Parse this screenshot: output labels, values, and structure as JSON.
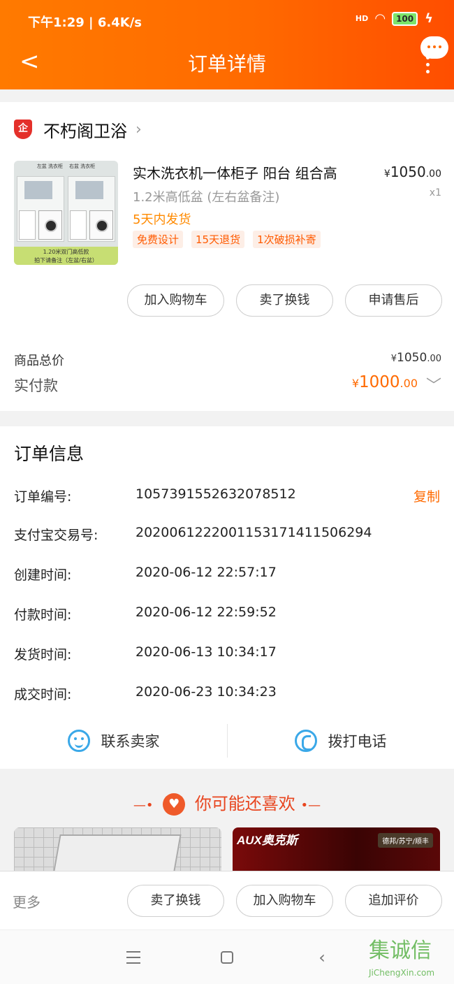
{
  "status_bar": {
    "left_text": "下午1:29 | 6.4K/s",
    "signal": "HD",
    "battery": "100"
  },
  "header": {
    "title": "订单详情",
    "back_icon": "chevron-left-icon",
    "more_icon": "more-vertical-icon"
  },
  "shop": {
    "badge": "企",
    "name": "不朽阁卫浴",
    "product": {
      "image_top_left": "左盆 洗衣柜",
      "image_top_right": "右盆 洗衣柜",
      "image_caption_1": "1.20米双门高低款",
      "image_caption_2": "拍下请备注（左盆/右盆）",
      "title": "实木洗衣机一体柜子 阳台 组合高",
      "price_currency": "¥",
      "price_int": "1050",
      "price_dec": ".00",
      "sku": "1.2米高低盆 (左右盆备注)",
      "qty": "x1",
      "shipping": "5天内发货",
      "tags": [
        "免费设计",
        "15天退货",
        "1次破损补寄"
      ]
    },
    "actions": [
      "加入购物车",
      "卖了换钱",
      "申请售后"
    ],
    "total_label": "商品总价",
    "total_currency": "¥",
    "total_int": "1050",
    "total_dec": ".00",
    "paid_label": "实付款",
    "paid_currency": "¥",
    "paid_int": "1000",
    "paid_dec": ".00"
  },
  "order_info": {
    "title": "订单信息",
    "copy_label": "复制",
    "rows": [
      {
        "label": "订单编号:",
        "value": "1057391552632078512"
      },
      {
        "label": "支付宝交易号:",
        "value": "2020061222001153171411506294"
      },
      {
        "label": "创建时间:",
        "value": "2020-06-12 22:57:17"
      },
      {
        "label": "付款时间:",
        "value": "2020-06-12 22:59:52"
      },
      {
        "label": "发货时间:",
        "value": "2020-06-13 10:34:17"
      },
      {
        "label": "成交时间:",
        "value": "2020-06-23 10:34:23"
      }
    ],
    "contact_seller": "联系卖家",
    "call_phone": "拨打电话"
  },
  "recommend": {
    "title": "你可能还喜欢",
    "dash": "—•",
    "dash_r": "•—",
    "right_logo": "AUX奥克斯",
    "right_tag": "德邦/苏宁/顺丰"
  },
  "bottom_bar": {
    "more": "更多",
    "actions": [
      "卖了换钱",
      "加入购物车",
      "追加评价"
    ]
  },
  "watermark": {
    "text": "集诚信",
    "url": "JiChengXin.com"
  }
}
